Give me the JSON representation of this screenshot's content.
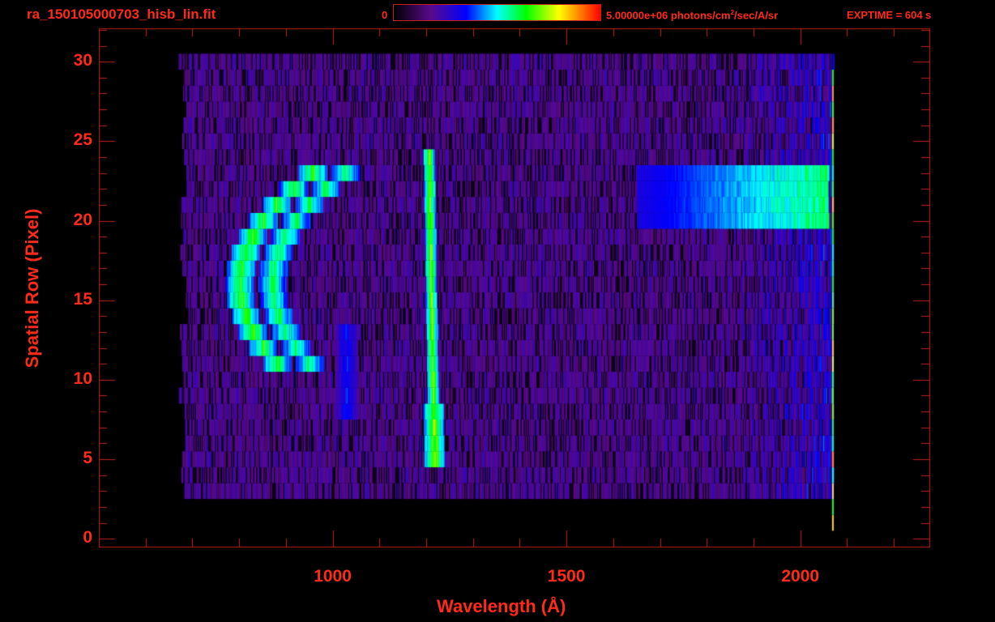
{
  "header": {
    "title": "ra_150105000703_hisb_lin.fit",
    "colorbar_min": "0",
    "colorbar_max": "5.00000e+06 photons/cm",
    "colorbar_unit_sup": "2",
    "colorbar_unit_rest": "/sec/A/sr",
    "exptime": "EXPTIME = 604 s"
  },
  "colors": {
    "axis": "#ff2a1a",
    "frame": "#c0201a",
    "background": "#000000"
  },
  "chart_data": {
    "type": "heatmap",
    "title": "ra_150105000703_hisb_lin.fit",
    "xlabel": "Wavelength (Å)",
    "ylabel": "Spatial Row (Pixel)",
    "xlim": [
      500,
      2276
    ],
    "ylim": [
      -0.5,
      32.1
    ],
    "x_ticks": [
      1000,
      1500,
      2000
    ],
    "x_tick_labels": [
      "1000",
      "1500",
      "2000"
    ],
    "x_minor_step": 100,
    "y_ticks": [
      0,
      5,
      10,
      15,
      20,
      25,
      30
    ],
    "y_tick_labels": [
      "0",
      "5",
      "10",
      "15",
      "20",
      "25",
      "30"
    ],
    "y_minor_step": 1,
    "color_range": [
      0,
      5000000
    ],
    "colormap": [
      "#000000",
      "#5a0a8c",
      "#0000ff",
      "#00ffff",
      "#00ff00",
      "#ffff00",
      "#ff0000"
    ],
    "data_extent": {
      "wavelength": [
        680,
        2070
      ],
      "rows": [
        3,
        30
      ]
    },
    "features": [
      {
        "name": "arc-outer",
        "rows": [
          11,
          23
        ],
        "wavelength_center": 800,
        "curvature": 3.2,
        "level": 0.66
      },
      {
        "name": "arc-inner",
        "rows": [
          11,
          23
        ],
        "wavelength_center": 870,
        "curvature": 3.2,
        "level": 0.6
      },
      {
        "name": "lyman-alpha",
        "rows": [
          5,
          24
        ],
        "wavelength_center": 1216,
        "level": 0.72
      },
      {
        "name": "faint-line",
        "rows": [
          8,
          13
        ],
        "wavelength_center": 1030,
        "level": 0.36
      },
      {
        "name": "continuum-band",
        "rows": [
          20,
          23
        ],
        "wavelength": [
          1650,
          2060
        ],
        "level": 0.6
      }
    ]
  }
}
